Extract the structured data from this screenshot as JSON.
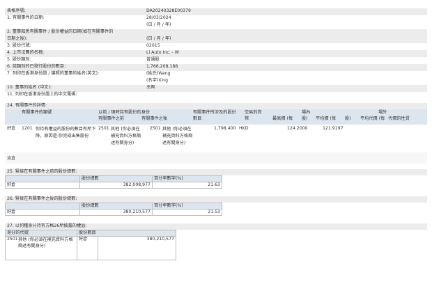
{
  "fields": [
    {
      "label": "表格序號:",
      "value": "DA20240328E00379",
      "value2": ""
    },
    {
      "label": "1. 有關事件的日期:",
      "value": "28/03/2024",
      "value2": "(日 / 月 / 年)"
    },
    {
      "label": "2. 董事知悉有關事件 / 股份權益的日期(如在有關事件的",
      "value": "",
      "value2": ""
    },
    {
      "label": "日期之後):",
      "value": "(日 / 月 / 年)",
      "value2": ""
    },
    {
      "label": "3. 股份代號:",
      "value": "02015",
      "value2": ""
    },
    {
      "label": "4. 上市法團的名稱:",
      "value": "Li Auto Inc. - W",
      "value2": ""
    },
    {
      "label": "5. 股份類別:",
      "value": "普通股",
      "value2": ""
    },
    {
      "label": "6. 該類別的已發行股份的數目:",
      "value": "1,766,208,188",
      "value2": ""
    },
    {
      "label": "7. 列印在香港身份證 / 護照的董事的姓名(英文):",
      "value": "(姓氏)Wang",
      "value2": "(名字)Xing"
    },
    {
      "label": "10. 董事的姓名 (中文):",
      "value": "王興",
      "value2": ""
    },
    {
      "label": "11. 列印在香港身份證上的中文電碼:",
      "value": "",
      "value2": ""
    }
  ],
  "section24": {
    "title": "24. 有關事件的詳情:",
    "headers": {
      "event_code": "有關事件的類號",
      "capacity": "以前 / 現時持有股份的身份",
      "before": "有關事件之前",
      "after": "有關事件之後",
      "shares": "有關事件所涉及的股份",
      "shares2": "數目",
      "currency": "交易的貨",
      "currency2": "幣",
      "onex": "場內",
      "highest": "最高價 (每",
      "highest2": "股)",
      "average": "平均價 (每",
      "average2": "股)",
      "offex": "場外",
      "offavg": "平均代價 (每",
      "offavg2": "股)",
      "nature": "代價的性質"
    },
    "row": {
      "position": "好倉",
      "code": "1201",
      "desc": "你持有權益的股份的數目有所下降，原因是:你完成出售股份",
      "before_code": "2501",
      "before_desc": "其他 (你必須在補充資料方格簡述有關身分)",
      "after_code": "2501",
      "after_desc": "其他 (你必須在補充資料方格簡述有關身分)",
      "shares": "1,798,400",
      "currency": "HKD",
      "highest": "124.2000",
      "average": "121.9197"
    },
    "short": "淡倉"
  },
  "section25": {
    "title": "25. 緊接在有關事件之前的股份總數:",
    "col1": "股份總數",
    "col2": "百分率數字(%)",
    "label": "好倉",
    "total": "382,008,977",
    "pct": "21.63"
  },
  "section26": {
    "title": "26. 緊接在有關事件之後的股份總數:",
    "col1": "股份總數",
    "col2": "百分率數字(%)",
    "label": "好倉",
    "total": "380,210,577",
    "pct": "21.53"
  },
  "section27": {
    "title": "27. 以何種身分持有方格26所披露的權益:",
    "col1": "身分的代號",
    "col2": "股份數目",
    "code": "2501",
    "desc": "其他 (你必須在補充資料方格簡述有關身分)",
    "label": "好倉",
    "total": "380,210,577"
  }
}
